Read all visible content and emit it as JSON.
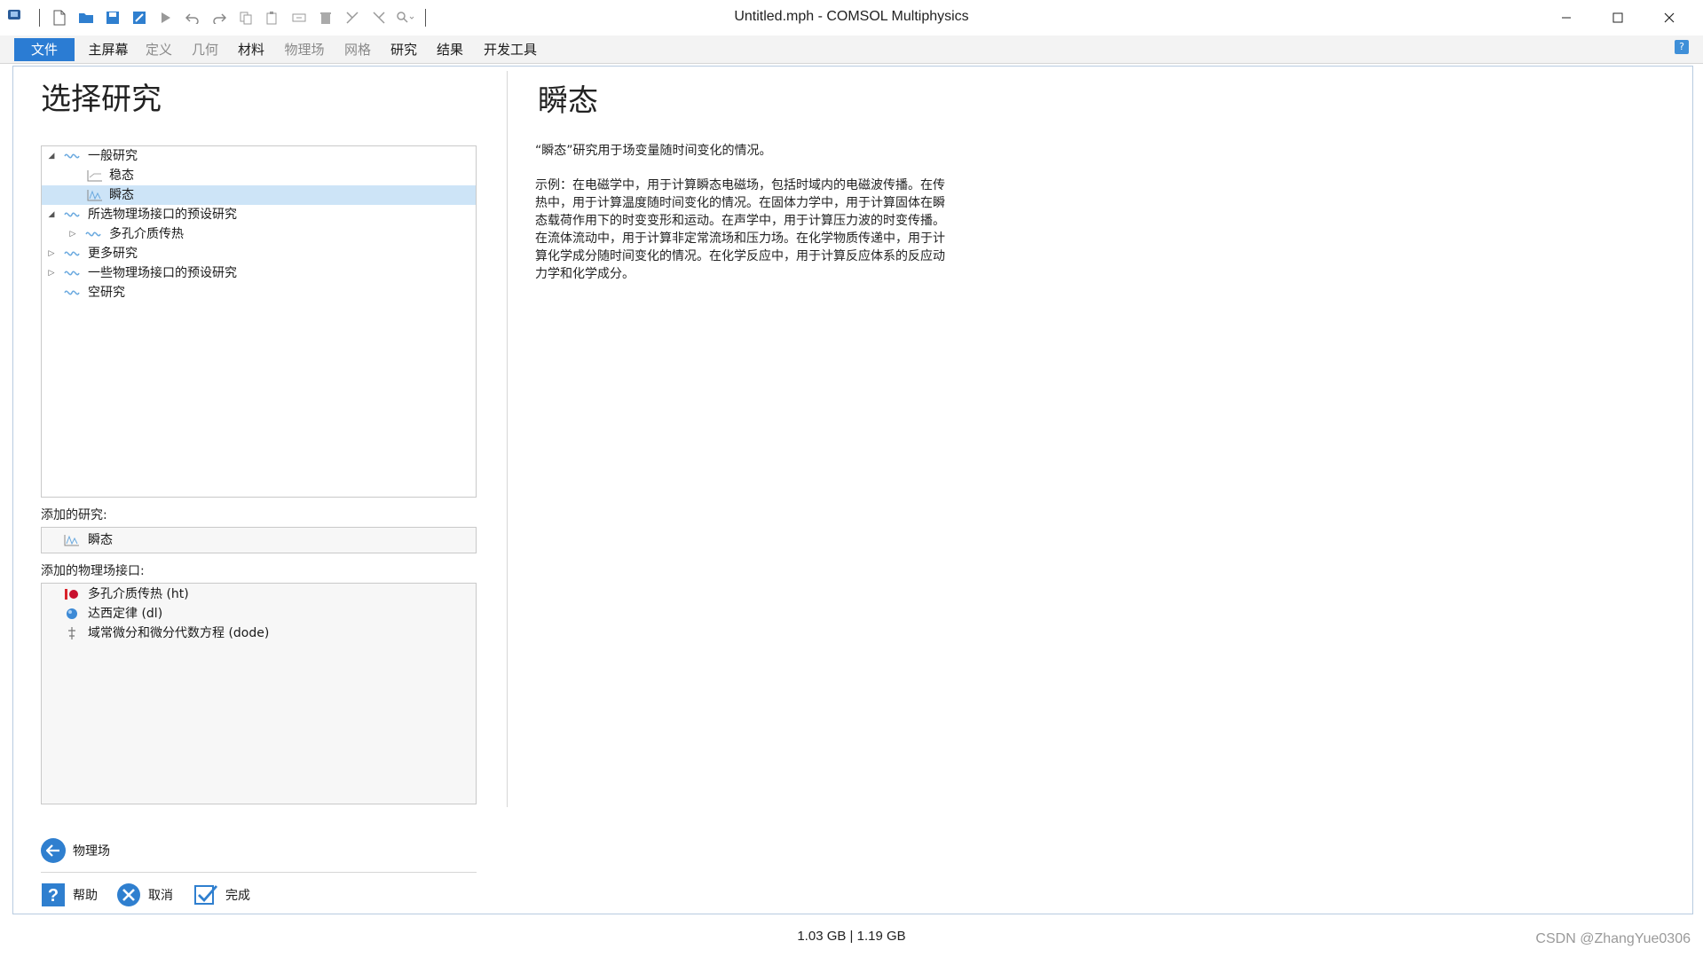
{
  "window": {
    "title": "Untitled.mph - COMSOL Multiphysics"
  },
  "ribbon": {
    "tabs": [
      {
        "label": "文件",
        "state": "active"
      },
      {
        "label": "主屏幕",
        "state": "enabled"
      },
      {
        "label": "定义",
        "state": "disabled"
      },
      {
        "label": "几何",
        "state": "disabled"
      },
      {
        "label": "材料",
        "state": "enabled"
      },
      {
        "label": "物理场",
        "state": "disabled"
      },
      {
        "label": "网格",
        "state": "disabled"
      },
      {
        "label": "研究",
        "state": "enabled"
      },
      {
        "label": "结果",
        "state": "enabled"
      },
      {
        "label": "开发工具",
        "state": "enabled"
      }
    ],
    "help_badge": "?"
  },
  "left": {
    "title": "选择研究",
    "tree": [
      {
        "label": "一般研究",
        "icon": "study-group-icon",
        "caret": "expanded"
      },
      {
        "label": "稳态",
        "icon": "stationary-icon",
        "caret": "none"
      },
      {
        "label": "瞬态",
        "icon": "transient-icon",
        "caret": "none",
        "selected": true
      },
      {
        "label": "所选物理场接口的预设研究",
        "icon": "study-group-icon",
        "caret": "expanded"
      },
      {
        "label": "多孔介质传热",
        "icon": "study-group-icon",
        "caret": "collapsed"
      },
      {
        "label": "更多研究",
        "icon": "study-group-icon",
        "caret": "collapsed"
      },
      {
        "label": "一些物理场接口的预设研究",
        "icon": "study-group-icon",
        "caret": "collapsed"
      },
      {
        "label": "空研究",
        "icon": "study-group-icon",
        "caret": "none"
      }
    ],
    "added_studies_label": "添加的研究:",
    "added_study": "瞬态",
    "added_physics_label": "添加的物理场接口:",
    "physics": [
      {
        "label": "多孔介质传热 (ht)",
        "icon": "heat-transfer-icon"
      },
      {
        "label": "达西定律 (dl)",
        "icon": "darcy-law-icon"
      },
      {
        "label": "域常微分和微分代数方程 (dode)",
        "icon": "ode-icon"
      }
    ],
    "back_button": "物理场",
    "help_button": "帮助",
    "cancel_button": "取消",
    "done_button": "完成"
  },
  "right": {
    "title": "瞬态",
    "summary": "“瞬态”研究用于场变量随时间变化的情况。",
    "example_lines": [
      "示例：在电磁学中，用于计算瞬态电磁场，包括时域内的电磁波传播。在传",
      "热中，用于计算温度随时间变化的情况。在固体力学中，用于计算固体在瞬",
      "态载荷作用下的时变变形和运动。在声学中，用于计算压力波的时变传播。",
      "在流体流动中，用于计算非定常流场和压力场。在化学物质传递中，用于计",
      "算化学成分随时间变化的情况。在化学反应中，用于计算反应体系的反应动",
      "力学和化学成分。"
    ]
  },
  "status": {
    "memory": "1.03 GB | 1.19 GB"
  },
  "watermark": "CSDN @ZhangYue0306",
  "colors": {
    "accent": "#2b7cd3",
    "selection": "#cde4f7"
  }
}
